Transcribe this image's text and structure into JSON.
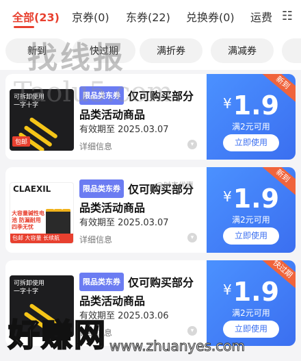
{
  "tabs": [
    {
      "label": "全部(23)",
      "active": true
    },
    {
      "label": "京券(0)",
      "active": false
    },
    {
      "label": "东券(22)",
      "active": false
    },
    {
      "label": "兑换券(0)",
      "active": false
    },
    {
      "label": "运费",
      "active": false
    }
  ],
  "more_icon": "grid-menu-icon",
  "more_glyph": "☷",
  "chips": [
    "新到",
    "快过期",
    "满折券",
    "满减券"
  ],
  "coupons": [
    {
      "type_badge": "限品类东券",
      "title": "仅可购买部分品类活动商品",
      "validity": "有效期至 2025.03.07",
      "detail": "详细信息",
      "currency": "¥",
      "amount": "1.9",
      "condition": "满2元可用",
      "use_label": "立即使用",
      "corner_tag": "新到",
      "thumb": {
        "line1": "可拆卸使用",
        "line2": "一字十字",
        "tag": "包邮"
      }
    },
    {
      "type_badge": "限品类东券",
      "title": "仅可购买部分品类活动商品",
      "validity": "有效期至 2025.03.07",
      "detail": "详细信息",
      "currency": "¥",
      "amount": "1.9",
      "condition": "满2元可用",
      "use_label": "立即使用",
      "corner_tag": "新到",
      "thumb": {
        "brand": "CLAEXIL",
        "promo": "大容量碱性电池 防漏耐用 四季无忧",
        "bar": "包邮 大容量 长续航"
      }
    },
    {
      "type_badge": "限品类东券",
      "title": "仅可购买部分品类活动商品",
      "validity": "有效期至 2025.03.06",
      "detail": "详细信息",
      "currency": "¥",
      "amount": "1.9",
      "condition": "满2元可用",
      "use_label": "立即使用",
      "corner_tag": "快过期",
      "thumb": {
        "line1": "可拆卸使用",
        "line2": "一字十字"
      }
    }
  ],
  "watermarks": {
    "top": "找线报",
    "mid": "Taolu5.com",
    "small": "@时来优惠",
    "logo": "好赚网",
    "url": "www.zhuanyes.com"
  },
  "colors": {
    "accent": "#e8402f",
    "coupon_blue": "#3b6ff0",
    "tag_orange": "#f0643c"
  }
}
